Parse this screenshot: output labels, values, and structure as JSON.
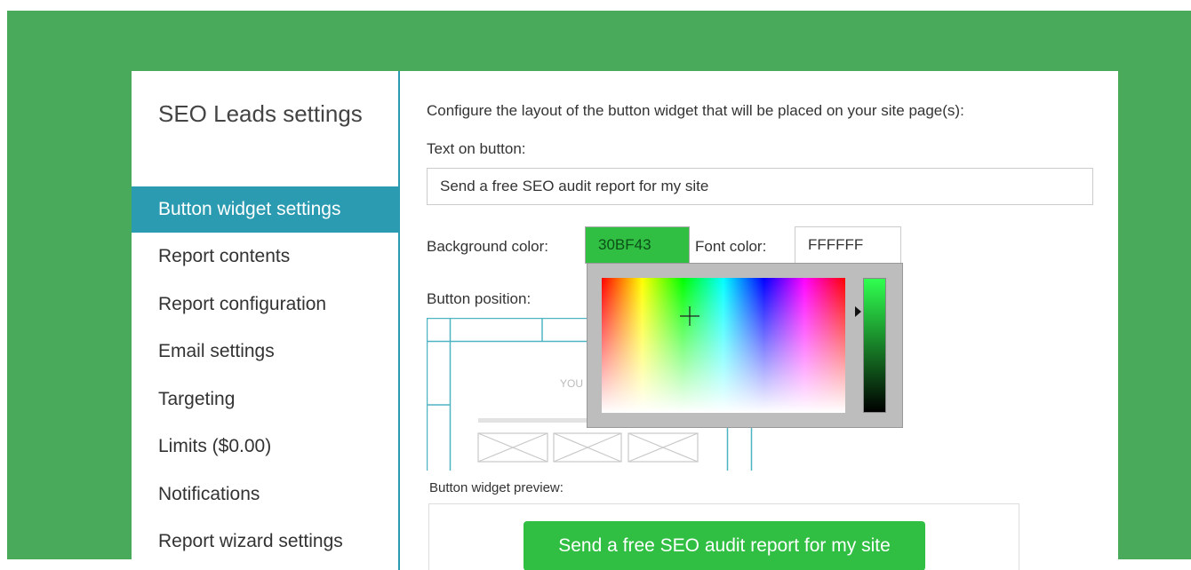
{
  "sidebar": {
    "title": "SEO Leads settings",
    "items": [
      {
        "label": "Button widget settings",
        "active": true
      },
      {
        "label": "Report contents"
      },
      {
        "label": "Report configuration"
      },
      {
        "label": "Email settings"
      },
      {
        "label": "Targeting"
      },
      {
        "label": "Limits ($0.00)"
      },
      {
        "label": "Notifications"
      },
      {
        "label": "Report wizard settings"
      }
    ]
  },
  "main": {
    "intro": "Configure the layout of the button widget that will be placed on your site page(s):",
    "text_on_button_label": "Text on button:",
    "text_on_button_value": "Send a free SEO audit report for my site",
    "background_color_label": "Background color:",
    "background_color_value": "30BF43",
    "font_color_label": "Font color:",
    "font_color_value": "FFFFFF",
    "button_position_label": "Button position:",
    "position_grid_text_1": "YOU",
    "preview_label": "Button widget preview:",
    "preview_button_text": "Send a free SEO audit report for my site"
  },
  "colors": {
    "frame_bg": "#4aaa5c",
    "accent": "#2a9bb0",
    "button_bg": "#30bf43",
    "button_text": "#ffffff"
  }
}
